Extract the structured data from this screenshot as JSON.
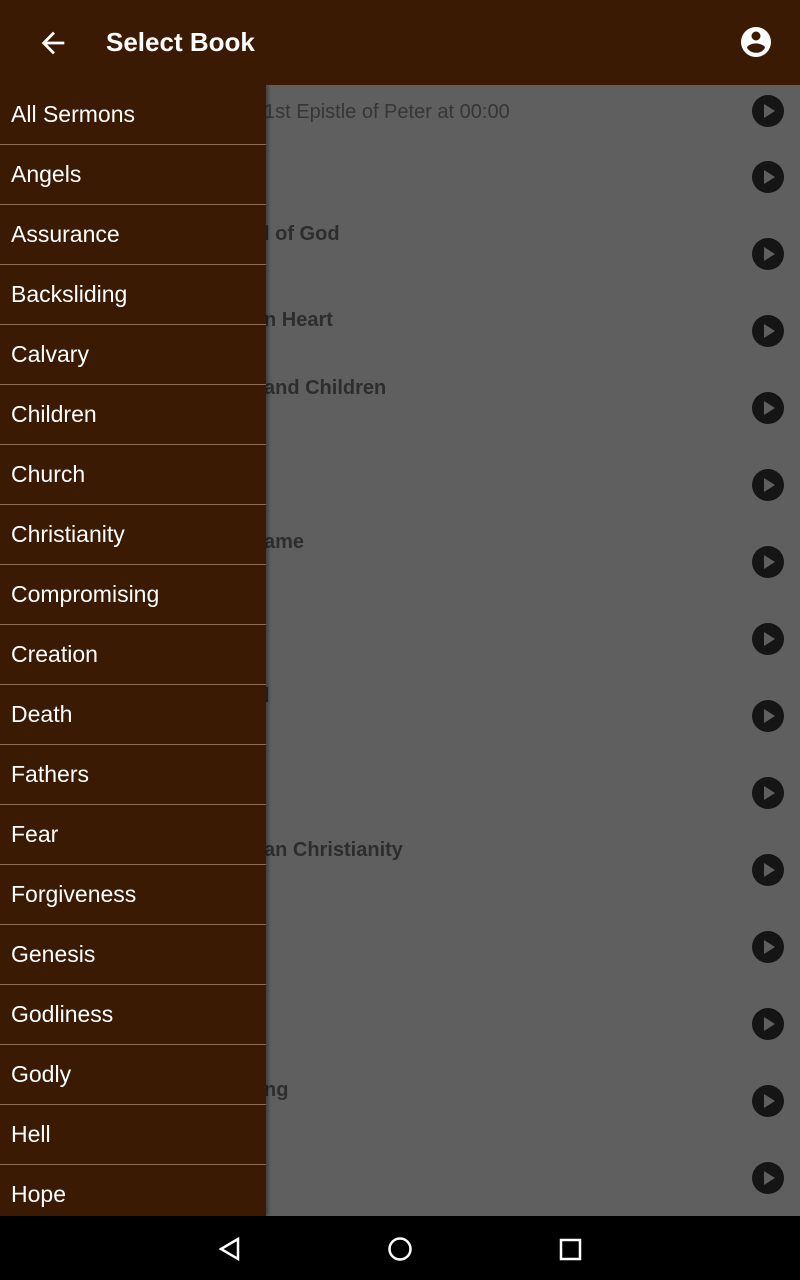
{
  "colors": {
    "brand": "#3a1a03"
  },
  "appbar": {
    "title": "Select Book",
    "back_icon": "arrow-left-icon",
    "account_icon": "account-circle-icon"
  },
  "drawer": {
    "items": [
      "All Sermons",
      "Angels",
      "Assurance",
      "Backsliding",
      "Calvary",
      "Children",
      "Church",
      "Christianity",
      "Compromising",
      "Creation",
      "Death",
      "Fathers",
      "Fear",
      "Forgiveness",
      "Genesis",
      "Godliness",
      "Godly",
      "Hell",
      "Hope"
    ]
  },
  "background_list": {
    "rows": [
      {
        "text": "1st Epistle of Peter at 00:00",
        "style": "light"
      },
      {
        "text": ""
      },
      {
        "text": "l of God"
      },
      {
        "text": "n Heart"
      },
      {
        "text": " and Children"
      },
      {
        "text": ""
      },
      {
        "text": "ame"
      },
      {
        "text": ""
      },
      {
        "text": "l"
      },
      {
        "text": ""
      },
      {
        "text": "an Christianity"
      },
      {
        "text": ""
      },
      {
        "text": ""
      },
      {
        "text": "ng"
      },
      {
        "text": ""
      }
    ]
  },
  "navbar": {
    "back": "triangle-back-icon",
    "home": "circle-home-icon",
    "recents": "square-recents-icon"
  }
}
